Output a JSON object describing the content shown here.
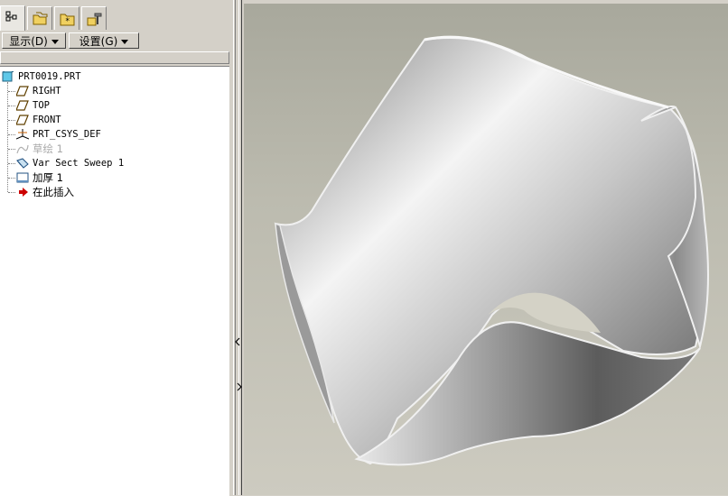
{
  "tabs": [
    {
      "icon": "model-tree-icon",
      "active": true
    },
    {
      "icon": "folder-browser-icon",
      "active": false
    },
    {
      "icon": "favorites-icon",
      "active": false
    },
    {
      "icon": "connections-icon",
      "active": false
    }
  ],
  "toolbar": {
    "show_label": "显示(D)",
    "settings_label": "设置(G)"
  },
  "tree": {
    "root": "PRT0019.PRT",
    "items": [
      {
        "label": "RIGHT",
        "icon": "datum-plane-icon",
        "suppressed": false
      },
      {
        "label": "TOP",
        "icon": "datum-plane-icon",
        "suppressed": false
      },
      {
        "label": "FRONT",
        "icon": "datum-plane-icon",
        "suppressed": false
      },
      {
        "label": "PRT_CSYS_DEF",
        "icon": "coordinate-system-icon",
        "suppressed": false
      },
      {
        "label": "草绘 1",
        "icon": "sketch-icon",
        "suppressed": true
      },
      {
        "label": "Var Sect Sweep 1",
        "icon": "variable-section-sweep-icon",
        "suppressed": false
      },
      {
        "label": "加厚 1",
        "icon": "thicken-icon",
        "suppressed": false
      },
      {
        "label": "在此插入",
        "icon": "insert-here-arrow-icon",
        "suppressed": false
      }
    ]
  },
  "colors": {
    "panel": "#d4d0c8",
    "tree_bg": "#ffffff",
    "insert_arrow": "#cc0000",
    "viewport_top": "#a8a89c",
    "viewport_bottom": "#cdcbc0"
  }
}
